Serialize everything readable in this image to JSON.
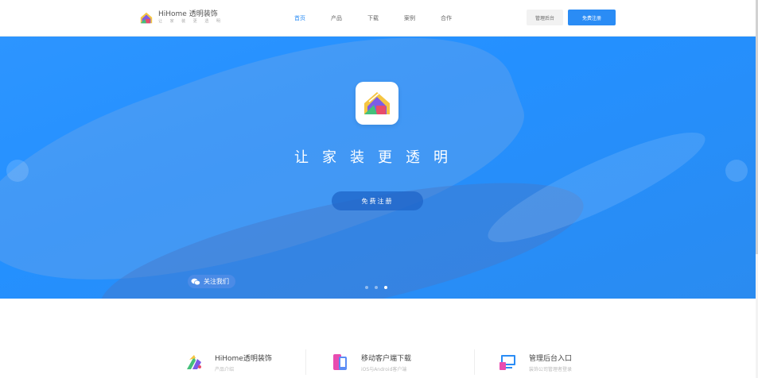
{
  "header": {
    "logo_name": "HiHome 透明装饰",
    "logo_tagline": "让 家 装 更 透 明",
    "nav": [
      {
        "label": "首页",
        "active": true
      },
      {
        "label": "产品",
        "active": false
      },
      {
        "label": "下载",
        "active": false
      },
      {
        "label": "案例",
        "active": false
      },
      {
        "label": "合作",
        "active": false
      }
    ],
    "admin_label": "管理后台",
    "register_label": "免费注册"
  },
  "hero": {
    "slogan": "让家装更透明",
    "cta_label": "免费注册",
    "wechat_label": "关注我们",
    "carousel": {
      "count": 3,
      "active_index": 2
    }
  },
  "features": [
    {
      "title": "HiHome透明装饰",
      "subtitle": "产品介绍",
      "icon": "brand-icon"
    },
    {
      "title": "移动客户端下载",
      "subtitle": "iOS与Android客户端",
      "icon": "phone-icon"
    },
    {
      "title": "管理后台入口",
      "subtitle": "装饰公司管理者登录",
      "icon": "monitor-icon"
    }
  ],
  "colors": {
    "accent": "#2a8cf5",
    "hero_bg": "#2490ff"
  }
}
